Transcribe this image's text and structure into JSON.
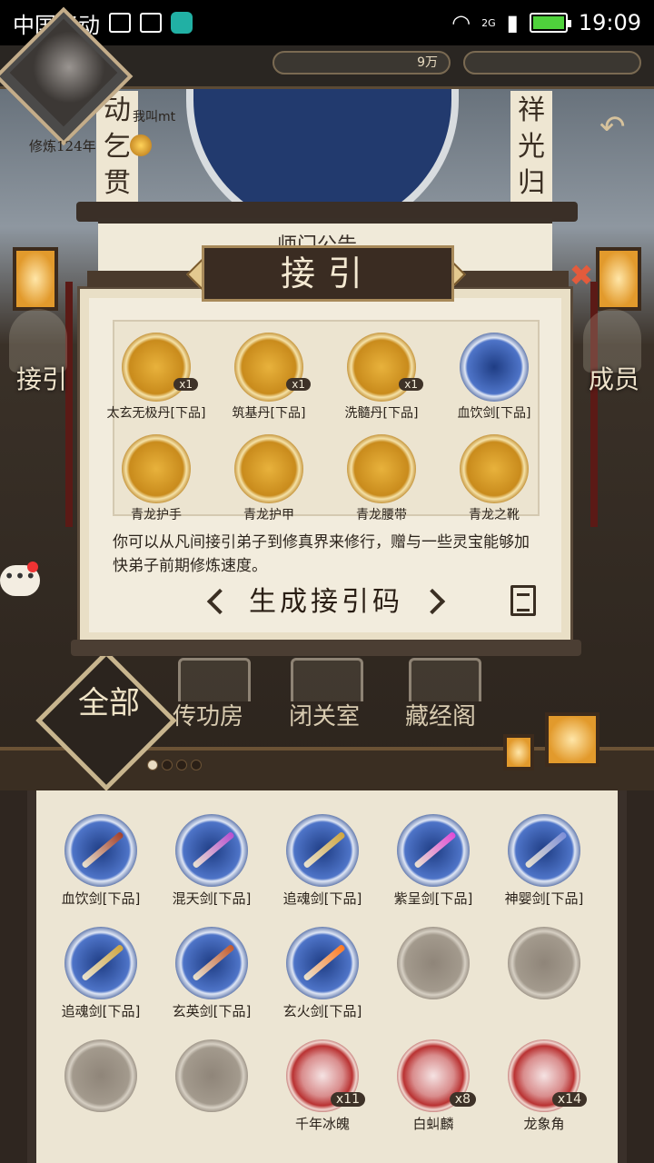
{
  "status_bar": {
    "carrier": "中国移动",
    "network": "2G",
    "time": "19:09"
  },
  "header": {
    "player_name": "我叫mt",
    "cultivation": "修炼124年",
    "resource_1": "9万"
  },
  "scene": {
    "couplet_left": "动乞贯黄",
    "couplet_right": "祥光归紫",
    "notice_title": "师门公告",
    "left_action": "接引",
    "right_action": "成员"
  },
  "modal": {
    "title": "接引",
    "rewards": [
      {
        "name": "太玄无极丹[下品]",
        "count": "x1",
        "style": "gold"
      },
      {
        "name": "筑基丹[下品]",
        "count": "x1",
        "style": "gold"
      },
      {
        "name": "洗髓丹[下品]",
        "count": "x1",
        "style": "gold"
      },
      {
        "name": "血饮剑[下品]",
        "count": "",
        "style": "blue"
      },
      {
        "name": "青龙护手",
        "count": "",
        "style": "gold"
      },
      {
        "name": "青龙护甲",
        "count": "",
        "style": "gold"
      },
      {
        "name": "青龙腰带",
        "count": "",
        "style": "gold"
      },
      {
        "name": "青龙之靴",
        "count": "",
        "style": "gold"
      }
    ],
    "description": "你可以从凡间接引弟子到修真界来修行，赠与一些灵宝能够加快弟子前期修炼速度。",
    "generate_button": "生成接引码"
  },
  "tabs": {
    "all": "全部",
    "items": [
      "传功房",
      "闭关室",
      "藏经阁"
    ]
  },
  "inventory": [
    {
      "name": "血饮剑[下品]",
      "count": "",
      "style": "blue",
      "blade": "#a3402a"
    },
    {
      "name": "混天剑[下品]",
      "count": "",
      "style": "blue",
      "blade": "#b84fd0"
    },
    {
      "name": "追魂剑[下品]",
      "count": "",
      "style": "blue",
      "blade": "#d0a640"
    },
    {
      "name": "紫呈剑[下品]",
      "count": "",
      "style": "blue",
      "blade": "#e04bd6"
    },
    {
      "name": "神婴剑[下品]",
      "count": "",
      "style": "blue",
      "blade": "#7e8fd8"
    },
    {
      "name": "追魂剑[下品]",
      "count": "",
      "style": "blue",
      "blade": "#d0a640"
    },
    {
      "name": "玄英剑[下品]",
      "count": "",
      "style": "blue",
      "blade": "#c35a2e"
    },
    {
      "name": "玄火剑[下品]",
      "count": "",
      "style": "blue",
      "blade": "#ff7a22"
    },
    {
      "name": "",
      "count": "",
      "style": "gray",
      "blade": ""
    },
    {
      "name": "",
      "count": "",
      "style": "gray",
      "blade": ""
    },
    {
      "name": "",
      "count": "",
      "style": "gray",
      "blade": ""
    },
    {
      "name": "",
      "count": "",
      "style": "gray",
      "blade": ""
    },
    {
      "name": "千年冰魄",
      "count": "x11",
      "style": "red",
      "blade": ""
    },
    {
      "name": "白虯麟",
      "count": "x8",
      "style": "red",
      "blade": ""
    },
    {
      "name": "龙象角",
      "count": "x14",
      "style": "red",
      "blade": ""
    }
  ]
}
